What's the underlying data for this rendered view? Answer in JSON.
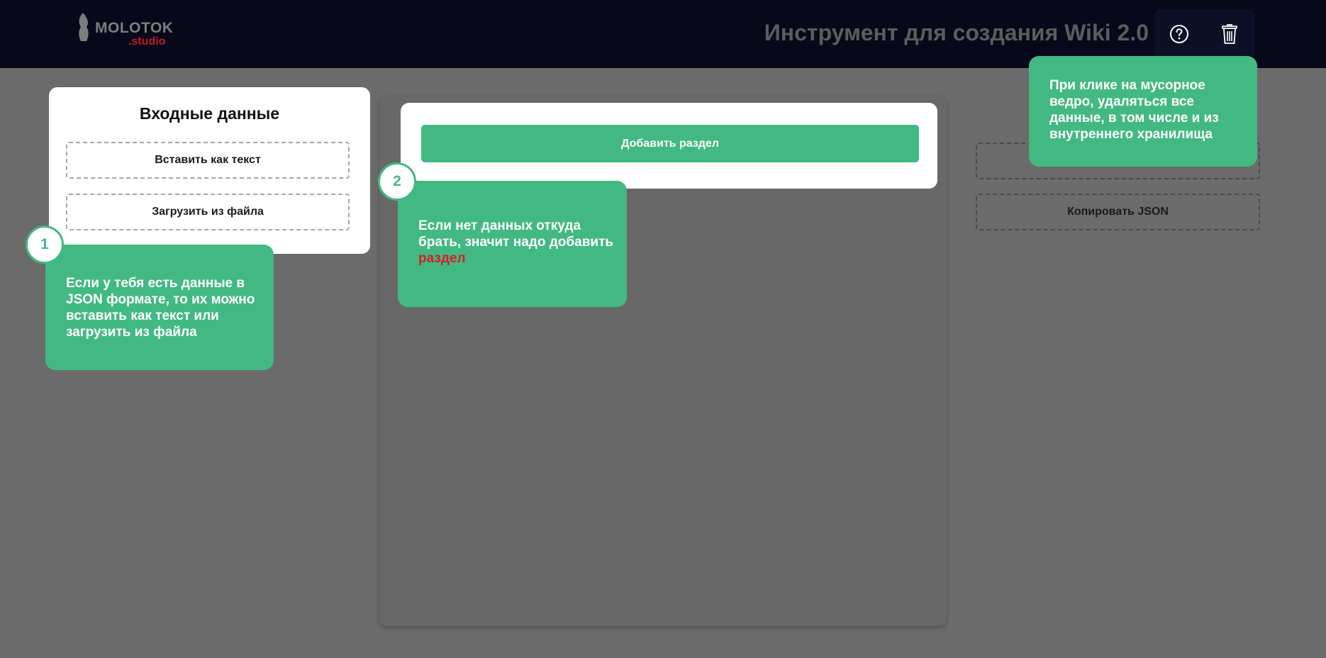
{
  "header": {
    "logo_text": "MOLOTOK",
    "logo_sub": ".studio",
    "title": "Инструмент для создания Wiki 2.0",
    "help_icon": "help-circle-icon",
    "trash_icon": "trash-icon"
  },
  "input_panel": {
    "title": "Входные данные",
    "paste_text_label": "Вставить как текст",
    "load_file_label": "Загрузить из файла"
  },
  "sections_panel": {
    "add_section_label": "Добавить раздел"
  },
  "output_panel": {
    "copy_json_label": "Копировать JSON"
  },
  "tooltips": {
    "tip1": {
      "badge": "1",
      "text": "Если у тебя есть данные в JSON формате, то их можно вставить как текст или загрузить из файла"
    },
    "tip2": {
      "badge": "2",
      "text": "Если нет данных откуда брать, значит надо добавить",
      "accent": "раздел"
    },
    "tip3": {
      "text": "При клике на мусорное ведро, удаляться все данные, в том числе и из внутреннего хранилища"
    }
  },
  "colors": {
    "header_bg": "#07081a",
    "accent": "#42b983",
    "overlay": "#6b6b6b",
    "danger": "#d61e25"
  }
}
